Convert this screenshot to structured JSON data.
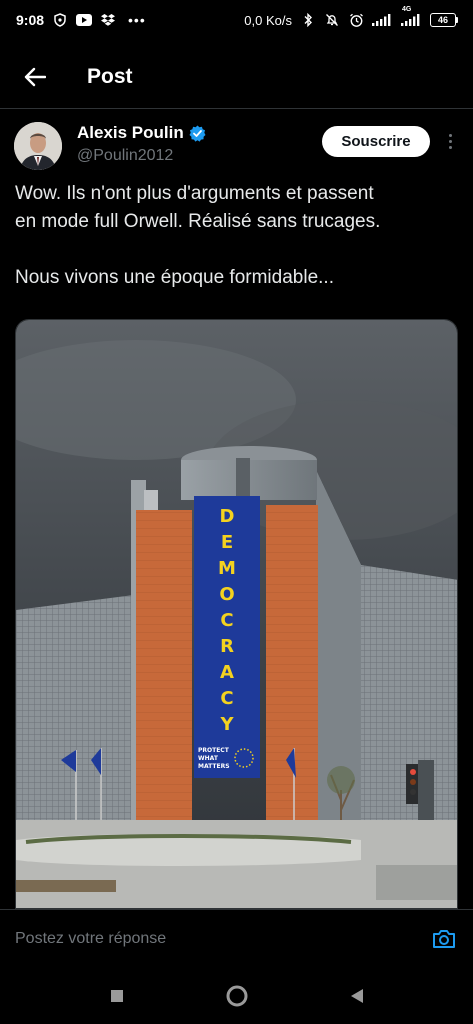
{
  "status_bar": {
    "time": "9:08",
    "network_speed": "0,0 Ko/s",
    "network_type": "4G",
    "battery": "46",
    "left_icons": [
      "shield-icon",
      "youtube-icon",
      "dropbox-icon",
      "more-notifications-icon"
    ],
    "right_icons": [
      "bluetooth-icon",
      "mute-icon",
      "alarm-icon",
      "signal-icon",
      "signal-4g-icon",
      "battery-icon"
    ]
  },
  "header": {
    "title": "Post",
    "back_icon": "back-arrow-icon"
  },
  "post": {
    "author_name": "Alexis Poulin",
    "author_handle": "@Poulin2012",
    "verified_icon": "verified-badge-icon",
    "subscribe_label": "Souscrire",
    "more_icon": "more-vertical-icon",
    "text_line_1": "Wow. Ils n'ont plus d'arguments et passent",
    "text_line_2": "en mode full Orwell. Réalisé sans trucages.",
    "text_line_3": "Nous vivons une époque formidable...",
    "image": {
      "banner_text": "DEMOCRACY",
      "banner_small_text_1": "PROTECT",
      "banner_small_text_2": "WHAT",
      "banner_small_text_3": "MATTERS",
      "colors": {
        "sky": "#4a4f55",
        "banner": "#1e3a9a",
        "banner_text": "#f4d21f",
        "facade": "#c76a3c"
      }
    }
  },
  "reply": {
    "placeholder": "Postez votre réponse",
    "camera_icon": "camera-icon"
  },
  "nav": {
    "icons": [
      "recents-square-icon",
      "home-circle-icon",
      "back-triangle-icon"
    ]
  },
  "colors": {
    "background": "#000000",
    "text": "#e7e9ea",
    "secondary_text": "#71767b",
    "accent": "#1d9bf0"
  }
}
